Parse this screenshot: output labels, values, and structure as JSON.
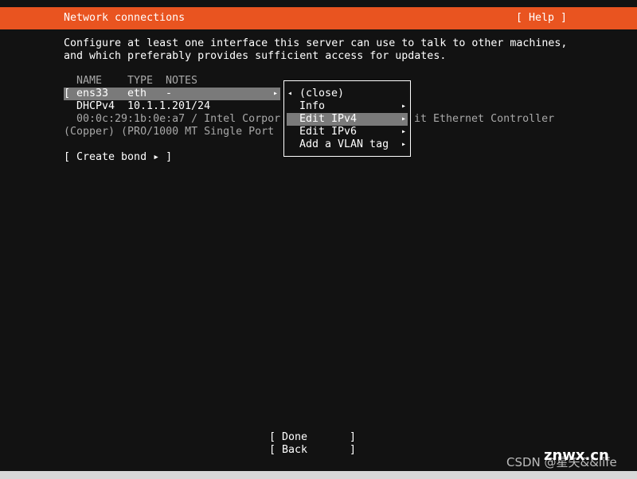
{
  "header": {
    "title": "Network connections",
    "help": "[ Help ]",
    "color": "#e95420"
  },
  "intro": [
    "Configure at least one interface this server can use to talk to other machines,",
    "and which preferably provides sufficient access for updates."
  ],
  "table": {
    "columns": [
      "NAME",
      "TYPE",
      "NOTES"
    ],
    "interface": {
      "open_bracket": "[",
      "name": "ens33",
      "type": "eth",
      "notes": "-",
      "arrow": "▸"
    },
    "address": {
      "method": "DHCPv4",
      "value": "10.1.1.201/24"
    },
    "info_line1_left": "00:0c:29:1b:0e:a7 / Intel Corpor",
    "info_line1_right": "it Ethernet Controller",
    "info_line2": "(Copper) (PRO/1000 MT Single Port"
  },
  "create_bond": "[ Create bond ▸ ]",
  "menu": {
    "close": {
      "arrow": "◂",
      "label": "(close)"
    },
    "items": [
      {
        "label": "Info",
        "arrow": "▸"
      },
      {
        "label": "Edit IPv4",
        "arrow": "▸",
        "selected": true
      },
      {
        "label": "Edit IPv6",
        "arrow": "▸"
      },
      {
        "label": "Add a VLAN tag",
        "arrow": "▸"
      }
    ]
  },
  "buttons": {
    "done": "[ Done",
    "done_end": "]",
    "back": "[ Back",
    "back_end": "]"
  },
  "watermark": {
    "text": "CSDN @星矢&&life",
    "overlay": "znwx.cn"
  }
}
